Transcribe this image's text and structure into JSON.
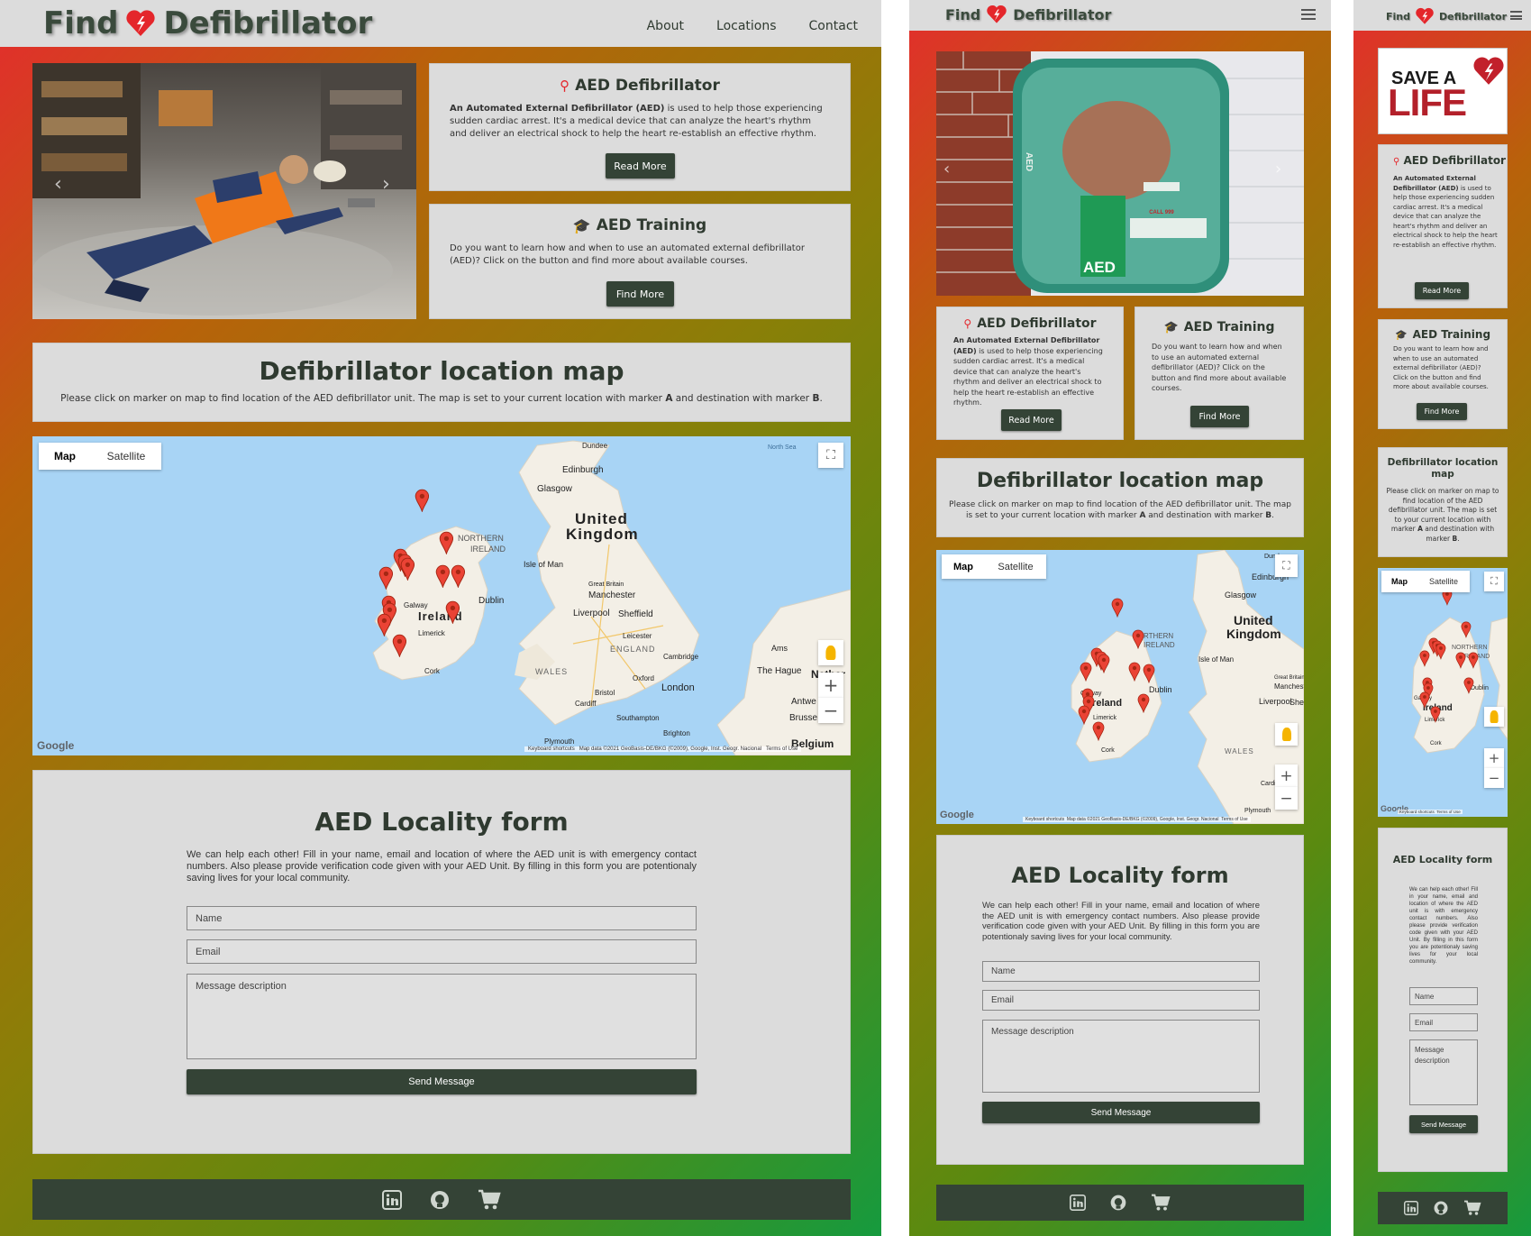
{
  "brand": {
    "word1": "Find",
    "word2": "Defibrillator"
  },
  "nav": {
    "about": "About",
    "locations": "Locations",
    "contact": "Contact"
  },
  "aed_card": {
    "title": "AED Defibrillator",
    "text_bold": "An Automated External Defibrillator (AED)",
    "text_rest": " is used to help those experiencing sudden cardiac arrest. It's a medical device that can analyze the heart's rhythm and deliver an electrical shock to help the heart re-establish an effective rhythm.",
    "button": "Read More"
  },
  "training_card": {
    "title": "AED Training",
    "text": "Do you want to learn how and when to use an automated external defibrillator (AED)? Click on the button and find more about available courses.",
    "button": "Find More"
  },
  "map_section": {
    "title": "Defibrillator location map",
    "text_start": "Please click on marker on map to find location of the AED defibrillator unit. The map is set to your current location with marker ",
    "marker_a": "A",
    "text_mid": " and destination with marker ",
    "marker_b": "B",
    "text_end": "."
  },
  "map": {
    "toggle_map": "Map",
    "toggle_satellite": "Satellite",
    "google": "Google",
    "footer_shortcuts": "Keyboard shortcuts",
    "footer_data": "Map data ©2021 GeoBasis-DE/BKG (©2009), Google, Inst. Geogr. Nacional",
    "footer_terms": "Terms of Use",
    "labels": {
      "north_sea": "North Sea",
      "dundee": "Dundee",
      "edinburgh": "Edinburgh",
      "glasgow": "Glasgow",
      "united": "United",
      "kingdom": "Kingdom",
      "northern": "NORTHERN",
      "ireland_ni": "IRELAND",
      "isle_of_man": "Isle of Man",
      "great_britain": "Great Britain",
      "manchester": "Manchester",
      "liverpool": "Liverpool",
      "sheffield": "Sheffield",
      "galway": "Galway",
      "ireland": "Ireland",
      "dublin": "Dublin",
      "limerick": "Limerick",
      "cork": "Cork",
      "leicester": "Leicester",
      "england": "ENGLAND",
      "wales": "WALES",
      "cambridge": "Cambridge",
      "oxford": "Oxford",
      "london": "London",
      "bristol": "Bristol",
      "cardiff": "Cardiff",
      "southampton": "Southampton",
      "brighton": "Brighton",
      "plymouth": "Plymouth",
      "amsterdam": "Ams",
      "the_hague": "The Hague",
      "netherlands": "Nether",
      "antwerp": "Antwe",
      "brussels": "Brusse",
      "belgium": "Belgium"
    }
  },
  "form": {
    "title": "AED Locality form",
    "text": "We can help each other! Fill in your name, email and location of where the AED unit is with emergency contact numbers. Also please provide verification code given with your AED Unit. By filling in this form you are potentionaly saving lives for your local community.",
    "name_placeholder": "Name",
    "email_placeholder": "Email",
    "message_placeholder": "Message description",
    "button": "Send Message"
  },
  "save_a_life": {
    "line1": "SAVE A",
    "line2": "LIFE"
  },
  "photo_labels": {
    "aed_box": "AED",
    "aed_side": "AED",
    "call": "CALL 999"
  },
  "footer_icons": [
    "linkedin-icon",
    "github-icon",
    "shopping-cart-icon"
  ],
  "colors": {
    "dark_green": "#344336",
    "panel": "#dcdcdc",
    "heart_red": "#e4262b",
    "map_water": "#a8d4f5"
  }
}
